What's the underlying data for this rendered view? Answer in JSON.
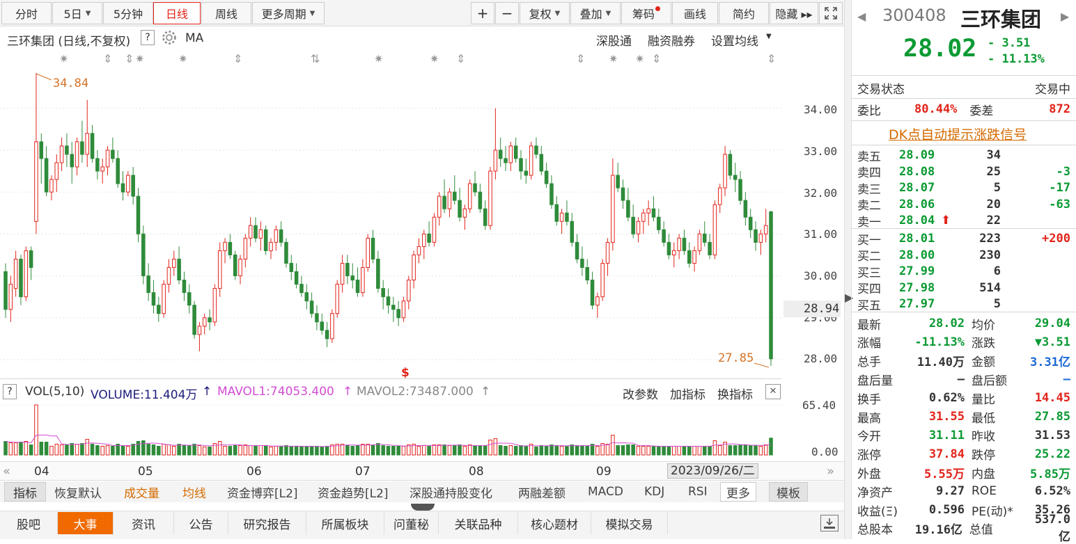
{
  "toolbar": {
    "periods": [
      "分时",
      "5日",
      "5分钟",
      "日线",
      "周线",
      "更多周期"
    ],
    "tools": [
      "+",
      "−",
      "复权",
      "叠加",
      "筹码",
      "画线",
      "简约",
      "隐藏 ▸▸"
    ],
    "expand_icon": "fullscreen-icon"
  },
  "chart_header": {
    "title": "三环集团 (日线,不复权)",
    "help": "?",
    "indicator": "MA",
    "links": [
      "深股通",
      "融资融券",
      "设置均线"
    ]
  },
  "colors": {
    "up": "#e2231a",
    "down": "#2e8b3a",
    "ma1": "#d24cd2",
    "ma2": "#888888",
    "label": "#d4732a"
  },
  "price_labels": {
    "high": "34.84",
    "low": "27.85",
    "current": "28.94"
  },
  "vol_header": {
    "help": "?",
    "vol": "VOL(5,10)",
    "volume": "VOLUME:11.404万",
    "mavol1": "MAVOL1:74053.400",
    "mavol2": "MAVOL2:73487.000",
    "arrow": "↑",
    "links": [
      "改参数",
      "加指标",
      "换指标"
    ],
    "close": "✕"
  },
  "date_tip": "2023/09/26/二",
  "indicator_tabs": [
    "指标",
    "恢复默认",
    "成交量",
    "均线",
    "资金博弈[L2]",
    "资金趋势[L2]",
    "深股通持股变化",
    "两融差额",
    "MACD",
    "KDJ",
    "RSI",
    "更多",
    "模板"
  ],
  "bottom_tabs": [
    "股吧",
    "大事",
    "资讯",
    "公告",
    "研究报告",
    "所属板块",
    "问董秘",
    "关联品种",
    "核心题材",
    "模拟交易"
  ],
  "quote": {
    "code": "300408",
    "name": "三环集团",
    "price": "28.02",
    "change": "- 3.51",
    "pct": "- 11.13%"
  },
  "status": {
    "label": "交易状态",
    "value": "交易中"
  },
  "weibi": {
    "label": "委比",
    "value": "80.44%",
    "diff_label": "委差",
    "diff": "872"
  },
  "dk_signal": "DK点自动提示涨跌信号",
  "asks": [
    {
      "label": "卖五",
      "price": "28.09",
      "vol": "34",
      "chg": ""
    },
    {
      "label": "卖四",
      "price": "28.08",
      "vol": "25",
      "chg": "-3"
    },
    {
      "label": "卖三",
      "price": "28.07",
      "vol": "5",
      "chg": "-17"
    },
    {
      "label": "卖二",
      "price": "28.06",
      "vol": "20",
      "chg": "-63"
    },
    {
      "label": "卖一",
      "price": "28.04",
      "vol": "22",
      "chg": ""
    }
  ],
  "bids": [
    {
      "label": "买一",
      "price": "28.01",
      "vol": "223",
      "chg": "+200"
    },
    {
      "label": "买二",
      "price": "28.00",
      "vol": "230",
      "chg": ""
    },
    {
      "label": "买三",
      "price": "27.99",
      "vol": "6",
      "chg": ""
    },
    {
      "label": "买四",
      "price": "27.98",
      "vol": "514",
      "chg": ""
    },
    {
      "label": "买五",
      "price": "27.97",
      "vol": "5",
      "chg": ""
    }
  ],
  "stats": [
    [
      "最新",
      "28.02",
      "grn",
      "均价",
      "29.04",
      "grn"
    ],
    [
      "涨幅",
      "-11.13%",
      "grn",
      "涨跌",
      "▼3.51",
      "grn"
    ],
    [
      "总手",
      "11.40万",
      "",
      "金额",
      "3.31亿",
      "blu"
    ],
    [
      "盘后量",
      "—",
      "",
      "盘后额",
      "—",
      "blu"
    ],
    [
      "换手",
      "0.62%",
      "",
      "量比",
      "14.45",
      "red"
    ],
    [
      "最高",
      "31.55",
      "red",
      "最低",
      "27.85",
      "grn"
    ],
    [
      "今开",
      "31.11",
      "grn",
      "昨收",
      "31.53",
      ""
    ],
    [
      "涨停",
      "37.84",
      "red",
      "跌停",
      "25.22",
      "grn"
    ],
    [
      "外盘",
      "5.55万",
      "red",
      "内盘",
      "5.85万",
      "grn"
    ],
    [
      "净资产",
      "9.27",
      "",
      "ROE",
      "6.52%",
      ""
    ],
    [
      "收益(Ξ)",
      "0.596",
      "",
      "PE(动)*",
      "35.26",
      ""
    ],
    [
      "总股本",
      "19.16亿",
      "",
      "总值",
      "537.0亿",
      ""
    ]
  ],
  "chart_data": {
    "type": "candlestick",
    "y_axis_ticks": [
      "34.00",
      "33.00",
      "32.00",
      "31.00",
      "30.00",
      "29.00",
      "28.00"
    ],
    "vol_axis_ticks": [
      "65.40",
      "0.00"
    ],
    "x_axis_ticks": [
      "04",
      "05",
      "06",
      "07",
      "08",
      "09"
    ],
    "ohlc": [
      [
        30.1,
        30.3,
        29.0,
        29.2
      ],
      [
        29.2,
        30.0,
        28.9,
        29.8
      ],
      [
        29.7,
        30.6,
        29.5,
        30.4
      ],
      [
        30.4,
        30.5,
        29.3,
        29.5
      ],
      [
        29.5,
        30.7,
        29.4,
        30.6
      ],
      [
        30.6,
        30.7,
        29.9,
        30.2
      ],
      [
        31.3,
        34.84,
        31.0,
        33.2
      ],
      [
        33.2,
        33.4,
        32.2,
        32.8
      ],
      [
        32.8,
        33.1,
        31.9,
        32.0
      ],
      [
        32.0,
        32.4,
        31.8,
        32.3
      ],
      [
        32.3,
        32.9,
        32.0,
        32.7
      ],
      [
        32.7,
        33.3,
        32.5,
        33.1
      ],
      [
        33.1,
        33.4,
        32.6,
        32.9
      ],
      [
        32.9,
        33.2,
        32.2,
        32.6
      ],
      [
        32.6,
        33.3,
        32.4,
        33.2
      ],
      [
        33.2,
        33.7,
        32.7,
        32.9
      ],
      [
        32.9,
        34.2,
        32.6,
        33.4
      ],
      [
        33.4,
        33.6,
        32.7,
        32.8
      ],
      [
        32.8,
        33.0,
        32.3,
        32.5
      ],
      [
        32.5,
        32.8,
        32.2,
        32.6
      ],
      [
        32.6,
        33.1,
        32.4,
        33.0
      ],
      [
        33.0,
        33.3,
        32.7,
        32.8
      ],
      [
        32.8,
        33.0,
        32.1,
        32.2
      ],
      [
        32.2,
        32.5,
        31.8,
        32.0
      ],
      [
        32.0,
        32.5,
        31.9,
        32.4
      ],
      [
        32.4,
        32.6,
        31.7,
        31.9
      ],
      [
        31.9,
        32.1,
        30.8,
        31.0
      ],
      [
        31.0,
        31.2,
        29.8,
        30.0
      ],
      [
        30.0,
        30.3,
        29.4,
        29.6
      ],
      [
        29.6,
        29.9,
        29.1,
        29.3
      ],
      [
        29.3,
        29.5,
        28.9,
        29.1
      ],
      [
        29.1,
        29.9,
        29.0,
        29.8
      ],
      [
        29.8,
        30.4,
        29.6,
        30.2
      ],
      [
        30.2,
        30.6,
        30.0,
        30.4
      ],
      [
        30.4,
        30.7,
        29.8,
        29.9
      ],
      [
        29.9,
        30.1,
        29.4,
        29.6
      ],
      [
        29.6,
        29.8,
        29.1,
        29.3
      ],
      [
        29.3,
        29.4,
        28.5,
        28.6
      ],
      [
        28.6,
        28.9,
        28.2,
        28.8
      ],
      [
        28.8,
        29.1,
        28.6,
        29.0
      ],
      [
        29.0,
        29.2,
        28.7,
        28.9
      ],
      [
        28.9,
        29.8,
        28.8,
        29.7
      ],
      [
        29.7,
        30.8,
        29.5,
        30.6
      ],
      [
        30.6,
        30.9,
        30.3,
        30.8
      ],
      [
        30.8,
        31.0,
        30.4,
        30.5
      ],
      [
        30.5,
        30.6,
        29.9,
        30.0
      ],
      [
        30.0,
        30.5,
        29.8,
        30.4
      ],
      [
        30.4,
        31.0,
        30.2,
        30.9
      ],
      [
        30.9,
        31.4,
        30.7,
        31.2
      ],
      [
        31.2,
        31.4,
        30.8,
        30.9
      ],
      [
        30.9,
        31.3,
        30.6,
        31.1
      ],
      [
        31.1,
        31.2,
        30.5,
        30.6
      ],
      [
        30.6,
        30.9,
        30.4,
        30.8
      ],
      [
        30.8,
        31.2,
        30.6,
        31.1
      ],
      [
        31.1,
        31.3,
        30.7,
        30.8
      ],
      [
        30.8,
        30.9,
        30.2,
        30.3
      ],
      [
        30.3,
        30.5,
        29.9,
        30.1
      ],
      [
        30.1,
        30.3,
        29.7,
        29.8
      ],
      [
        29.8,
        30.0,
        29.5,
        29.6
      ],
      [
        29.6,
        29.8,
        29.2,
        29.4
      ],
      [
        29.4,
        29.6,
        29.0,
        29.1
      ],
      [
        29.1,
        29.3,
        28.7,
        28.9
      ],
      [
        28.9,
        29.1,
        28.6,
        28.7
      ],
      [
        28.7,
        28.9,
        28.3,
        28.5
      ],
      [
        28.5,
        29.2,
        28.4,
        29.1
      ],
      [
        29.1,
        29.9,
        29.0,
        29.8
      ],
      [
        29.8,
        30.5,
        29.6,
        30.3
      ],
      [
        30.3,
        30.5,
        29.8,
        30.0
      ],
      [
        30.0,
        30.3,
        29.7,
        29.9
      ],
      [
        29.9,
        30.2,
        29.5,
        29.6
      ],
      [
        29.6,
        30.4,
        29.5,
        30.2
      ],
      [
        30.2,
        31.0,
        30.1,
        30.9
      ],
      [
        30.9,
        31.1,
        30.3,
        30.4
      ],
      [
        30.4,
        30.6,
        29.6,
        29.7
      ],
      [
        29.7,
        29.9,
        29.2,
        29.5
      ],
      [
        29.5,
        29.7,
        29.1,
        29.3
      ],
      [
        29.3,
        29.5,
        28.9,
        29.2
      ],
      [
        29.2,
        29.4,
        28.8,
        29.0
      ],
      [
        29.0,
        29.5,
        28.9,
        29.4
      ],
      [
        29.4,
        30.0,
        29.2,
        29.9
      ],
      [
        29.9,
        30.6,
        29.7,
        30.5
      ],
      [
        30.5,
        30.9,
        30.3,
        30.7
      ],
      [
        30.7,
        31.1,
        30.4,
        31.0
      ],
      [
        31.0,
        31.3,
        30.7,
        30.8
      ],
      [
        30.8,
        31.5,
        30.7,
        31.4
      ],
      [
        31.4,
        32.0,
        31.2,
        31.9
      ],
      [
        31.9,
        32.3,
        31.5,
        31.6
      ],
      [
        31.6,
        32.1,
        31.4,
        32.0
      ],
      [
        32.0,
        32.4,
        31.7,
        31.8
      ],
      [
        31.8,
        32.1,
        31.3,
        31.4
      ],
      [
        31.4,
        31.7,
        31.1,
        31.6
      ],
      [
        31.6,
        32.3,
        31.5,
        32.2
      ],
      [
        32.2,
        32.5,
        31.9,
        32.0
      ],
      [
        32.0,
        32.2,
        31.5,
        31.6
      ],
      [
        31.6,
        31.8,
        31.1,
        31.2
      ],
      [
        31.2,
        32.6,
        31.1,
        32.5
      ],
      [
        32.5,
        34.0,
        32.3,
        33.0
      ],
      [
        33.0,
        33.3,
        32.6,
        32.8
      ],
      [
        32.8,
        33.1,
        32.5,
        32.7
      ],
      [
        32.7,
        33.2,
        32.5,
        33.1
      ],
      [
        33.1,
        33.3,
        32.7,
        32.8
      ],
      [
        32.8,
        33.0,
        32.3,
        32.5
      ],
      [
        32.5,
        32.8,
        32.2,
        32.4
      ],
      [
        32.4,
        33.2,
        32.3,
        33.1
      ],
      [
        33.1,
        33.3,
        32.8,
        32.9
      ],
      [
        32.9,
        33.1,
        32.4,
        32.5
      ],
      [
        32.5,
        32.7,
        32.1,
        32.2
      ],
      [
        32.2,
        32.4,
        31.6,
        31.7
      ],
      [
        31.7,
        31.9,
        31.2,
        31.3
      ],
      [
        31.3,
        31.6,
        31.0,
        31.5
      ],
      [
        31.5,
        31.8,
        31.2,
        31.3
      ],
      [
        31.3,
        31.5,
        30.7,
        30.8
      ],
      [
        30.8,
        31.0,
        30.3,
        30.4
      ],
      [
        30.4,
        30.7,
        30.0,
        30.2
      ],
      [
        30.2,
        30.4,
        29.8,
        29.9
      ],
      [
        29.9,
        30.1,
        29.2,
        29.3
      ],
      [
        29.3,
        29.6,
        29.0,
        29.5
      ],
      [
        29.5,
        30.4,
        29.4,
        30.3
      ],
      [
        30.3,
        30.9,
        30.0,
        30.8
      ],
      [
        30.8,
        32.8,
        30.6,
        32.4
      ],
      [
        32.4,
        32.7,
        32.0,
        32.1
      ],
      [
        32.1,
        32.3,
        31.6,
        31.8
      ],
      [
        31.8,
        32.1,
        31.3,
        31.4
      ],
      [
        31.4,
        31.7,
        30.9,
        31.0
      ],
      [
        31.0,
        31.4,
        30.8,
        31.3
      ],
      [
        31.3,
        31.6,
        31.0,
        31.5
      ],
      [
        31.5,
        31.8,
        31.2,
        31.6
      ],
      [
        31.6,
        31.9,
        31.3,
        31.4
      ],
      [
        31.4,
        31.6,
        31.0,
        31.1
      ],
      [
        31.1,
        31.3,
        30.7,
        30.8
      ],
      [
        30.8,
        31.0,
        30.4,
        30.5
      ],
      [
        30.5,
        30.8,
        30.2,
        30.6
      ],
      [
        30.6,
        31.0,
        30.4,
        30.9
      ],
      [
        30.9,
        31.1,
        30.5,
        30.6
      ],
      [
        30.6,
        30.8,
        30.2,
        30.3
      ],
      [
        30.3,
        30.7,
        30.1,
        30.6
      ],
      [
        30.6,
        31.1,
        30.5,
        31.0
      ],
      [
        31.0,
        31.3,
        30.7,
        30.8
      ],
      [
        30.8,
        31.0,
        30.4,
        30.5
      ],
      [
        30.5,
        31.8,
        30.4,
        31.7
      ],
      [
        31.7,
        32.2,
        31.5,
        32.1
      ],
      [
        32.1,
        33.1,
        31.9,
        32.9
      ],
      [
        32.9,
        33.0,
        32.3,
        32.4
      ],
      [
        32.4,
        32.7,
        32.0,
        32.3
      ],
      [
        32.3,
        32.5,
        31.7,
        31.8
      ],
      [
        31.8,
        32.0,
        31.2,
        31.4
      ],
      [
        31.4,
        31.6,
        30.9,
        31.1
      ],
      [
        31.1,
        31.3,
        30.6,
        30.8
      ],
      [
        30.8,
        31.1,
        30.5,
        31.0
      ],
      [
        31.0,
        31.6,
        30.8,
        31.2
      ],
      [
        31.53,
        31.55,
        27.85,
        28.02
      ]
    ],
    "volume_scale_max": 65.4
  }
}
